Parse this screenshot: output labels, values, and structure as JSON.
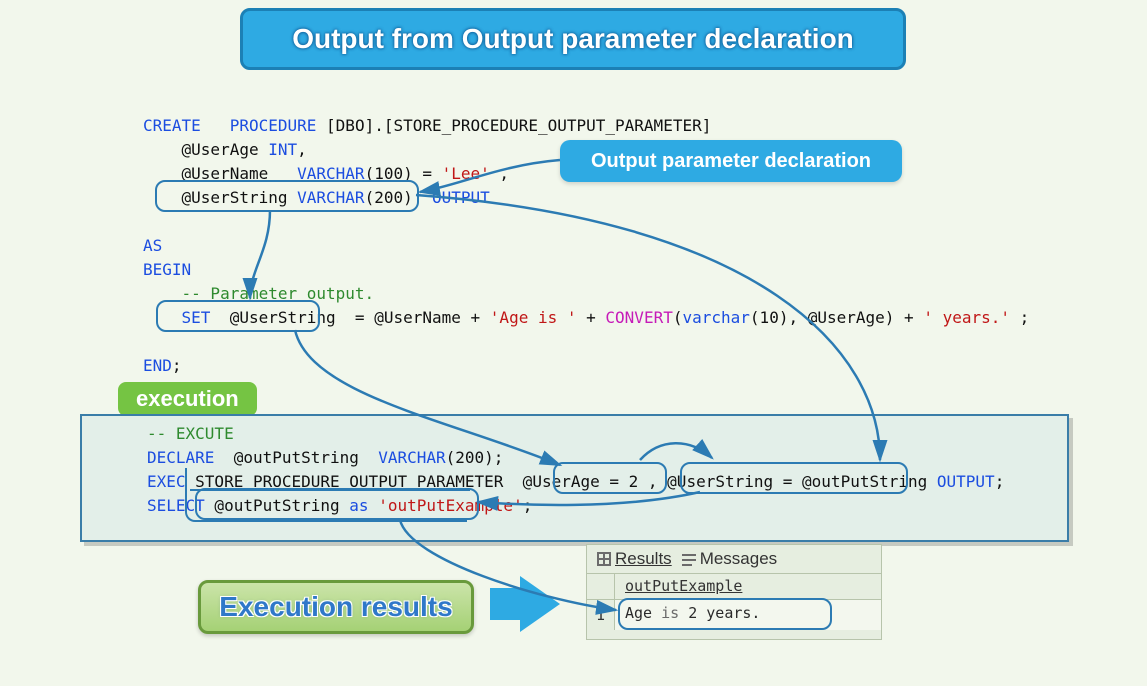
{
  "title": "Output from Output parameter declaration",
  "code": {
    "line1_kw1": "CREATE",
    "line1_kw2": "PROCEDURE",
    "line1_rest": " [DBO].[STORE_PROCEDURE_OUTPUT_PARAMETER]",
    "line2_a": "    @UserAge ",
    "line2_kw": "INT",
    "line2_b": ",",
    "line3_a": "    @UserName   ",
    "line3_kw": "VARCHAR",
    "line3_b": "(100) = ",
    "line3_str": "'Lee'",
    "line3_c": " ,",
    "line4_a": "    @UserString ",
    "line4_kw1": "VARCHAR",
    "line4_b": "(200)  ",
    "line4_kw2": "OUTPUT",
    "line5_blank": " ",
    "line6_kw": "AS",
    "line7_kw": "BEGIN",
    "line8_cmt": "    -- Parameter output.",
    "line9_kw": "SET",
    "line9_pre": "    ",
    "line9_a": "  @UserString  = @UserName + ",
    "line9_str1": "'Age is '",
    "line9_b": " + ",
    "line9_fn": "CONVERT",
    "line9_c": "(",
    "line9_kw2": "varchar",
    "line9_d": "(10), @UserAge) + ",
    "line9_str2": "' years.'",
    "line9_e": " ;",
    "line10_blank": " ",
    "line11_kw": "END",
    "line11_b": ";"
  },
  "callouts": {
    "output_decl": "Output parameter declaration",
    "execution": "execution",
    "results_banner": "Execution results"
  },
  "exec": {
    "line1_cmt": "-- EXCUTE",
    "line2_kw": "DECLARE",
    "line2_a": "  @outPutString  ",
    "line2_kw2": "VARCHAR",
    "line2_b": "(200);",
    "line3_kw": "EXEC",
    "line3_a": " STORE_PROCEDURE_OUTPUT_PARAMETER  @UserAge = 2 , @UserString = @outPutString ",
    "line3_kw2": "OUTPUT",
    "line3_b": ";",
    "line4_kw": "SELECT",
    "line4_a": " @outPutString ",
    "line4_kw2": "as",
    "line4_b": " ",
    "line4_str": "'outPutExample'",
    "line4_c": ";"
  },
  "results": {
    "tab_results": "Results",
    "tab_messages": "Messages",
    "column": "outPutExample",
    "row_num": "1",
    "cell": "Age is 2 years."
  }
}
